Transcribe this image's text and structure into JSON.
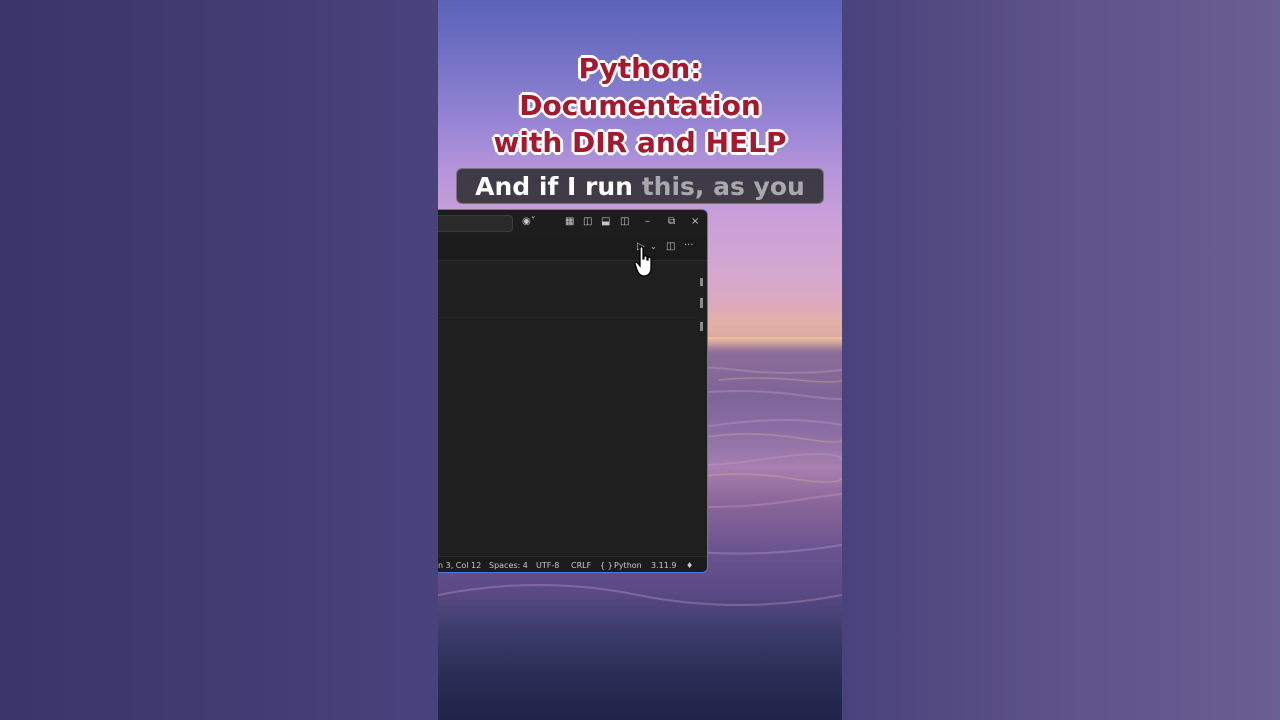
{
  "title": {
    "lines": [
      "Python:",
      "Documentation",
      "with DIR and HELP"
    ]
  },
  "caption": {
    "spoken": "And if I run",
    "upcoming": "this, as you"
  },
  "editor": {
    "statusbar": {
      "position": "n 3, Col 12",
      "spaces": "Spaces: 4",
      "encoding": "UTF-8",
      "eol": "CRLF",
      "language": "Python",
      "language_icon": "{ }",
      "version": "3.11.9"
    },
    "icons": {
      "copilot": "copilot-icon",
      "run": "run-icon",
      "split": "split-editor-icon",
      "more": "more-actions-icon"
    }
  },
  "colors": {
    "title_red": "#a3192f",
    "caption_bg": "#2d2d32",
    "editor_bg": "#1f1f1f",
    "window_border": "#4a7bdc"
  }
}
